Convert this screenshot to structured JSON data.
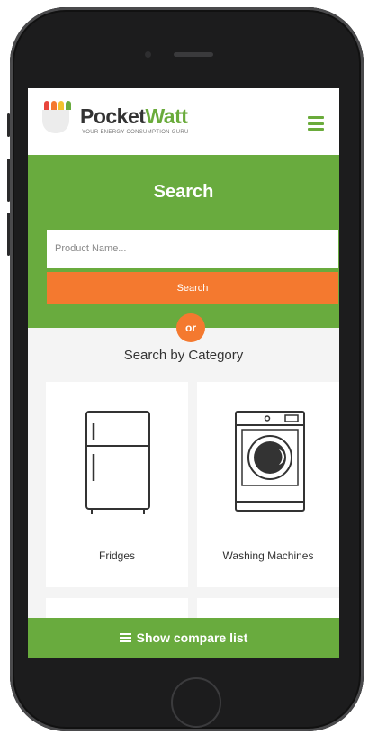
{
  "brand": {
    "name_part1": "Pocket",
    "name_part2": "Watt",
    "tagline": "YOUR ENERGY CONSUMPTION GURU",
    "colors": {
      "green": "#69ab3e",
      "orange": "#f4792f",
      "red": "#e8453c",
      "yellow": "#f2c12e"
    }
  },
  "header": {
    "menu_icon": "hamburger-menu-icon"
  },
  "search": {
    "heading": "Search",
    "placeholder": "Product Name...",
    "value": "",
    "button_label": "Search",
    "divider_label": "or"
  },
  "categories": {
    "heading": "Search by Category",
    "items": [
      {
        "label": "Fridges",
        "icon": "fridge-icon"
      },
      {
        "label": "Washing Machines",
        "icon": "washing-machine-icon"
      }
    ]
  },
  "compare_bar": {
    "label": "Show compare list",
    "icon": "list-icon"
  }
}
